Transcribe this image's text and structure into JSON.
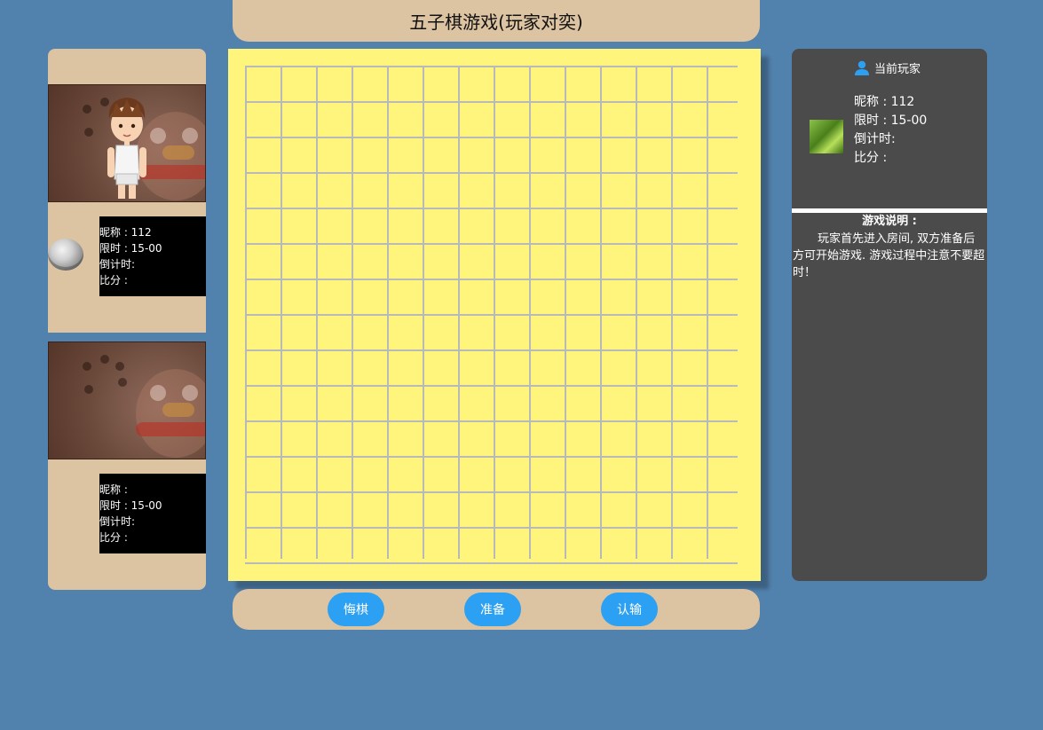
{
  "header": {
    "title": "五子棋游戏(玩家对奕)"
  },
  "player1": {
    "nickname_line": "昵称 : 112",
    "time_limit_line": "限时 : 15-00",
    "countdown_line": "倒计时:",
    "score_line": "比分 :"
  },
  "player2": {
    "nickname_line": "昵称 :",
    "time_limit_line": "限时 : 15-00",
    "countdown_line": "倒计时:",
    "score_line": "比分 :"
  },
  "current_player": {
    "title": "当前玩家",
    "nickname_line": "昵称 : 112",
    "time_limit_line": "限时 : 15-00",
    "countdown_line": "倒计时:",
    "score_line": "比分 :"
  },
  "rules": {
    "title": "游戏说明 :",
    "text": "玩家首先进入房间, 双方准备后方可开始游戏. 游戏过程中注意不要超时！"
  },
  "controls": {
    "undo_label": "悔棋",
    "ready_label": "准备",
    "surrender_label": "认输"
  },
  "board": {
    "columns": 14,
    "rows": 14
  },
  "colors": {
    "background": "#5181ad",
    "panel_tan": "#dcc3a1",
    "board_yellow": "#fff47c",
    "grid_line": "#b9b9b9",
    "button_blue": "#2ca0f2",
    "side_panel": "#4b4b4b"
  },
  "icons": {
    "current_player_icon": "user-icon",
    "stone_bowl": "white-stone-bowl-icon"
  }
}
